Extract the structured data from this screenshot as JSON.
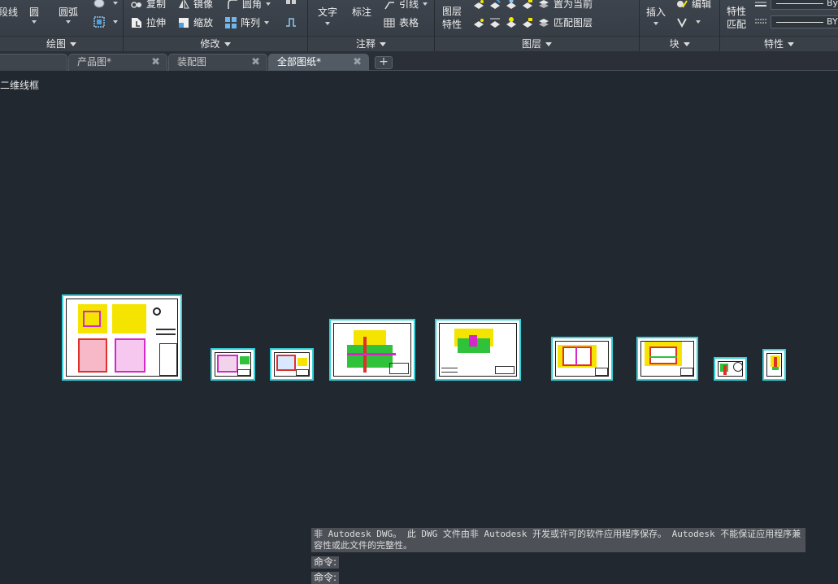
{
  "ribbon": {
    "draw": {
      "title": "绘图",
      "polyline": "段线",
      "circle": "圆",
      "arc": "圆弧"
    },
    "modify": {
      "title": "修改",
      "copy": "复制",
      "mirror": "镜像",
      "fillet": "圆角",
      "stretch": "拉伸",
      "scale": "缩放",
      "array": "阵列"
    },
    "annotation": {
      "title": "注释",
      "text": "文字",
      "dimension": "标注",
      "leader": "引线",
      "table": "表格"
    },
    "layers": {
      "title": "图层",
      "properties_line1": "图层",
      "properties_line2": "特性",
      "set_current": "置为当前",
      "match_layer": "匹配图层"
    },
    "block": {
      "title": "块",
      "insert": "插入",
      "edit": "编辑"
    },
    "properties": {
      "title": "特性",
      "match_line1": "特性",
      "match_line2": "匹配",
      "bylayer1": "By",
      "bylayer2": "BY"
    }
  },
  "tabs": [
    {
      "label": "",
      "active": false
    },
    {
      "label": "产品图*",
      "active": false
    },
    {
      "label": "装配图",
      "active": false
    },
    {
      "label": "全部图纸*",
      "active": true
    }
  ],
  "tab_add": "+",
  "tab_close": "✖",
  "canvas": {
    "view_label": "二维线框"
  },
  "command": {
    "message": "非 Autodesk DWG。 此 DWG 文件由非 Autodesk 开发或许可的软件应用程序保存。 Autodesk 不能保证应用程序兼容性或此文件的完整性。",
    "prompt1": "命令:",
    "prompt2": "命令:"
  },
  "colors": {
    "background": "#212830",
    "ribbon": "#3a4048",
    "sheet_border": "#35d0d8",
    "accent_yellow": "#f5e400",
    "accent_red": "#e0302a",
    "accent_magenta": "#d428c8",
    "accent_green": "#2fc23a"
  }
}
